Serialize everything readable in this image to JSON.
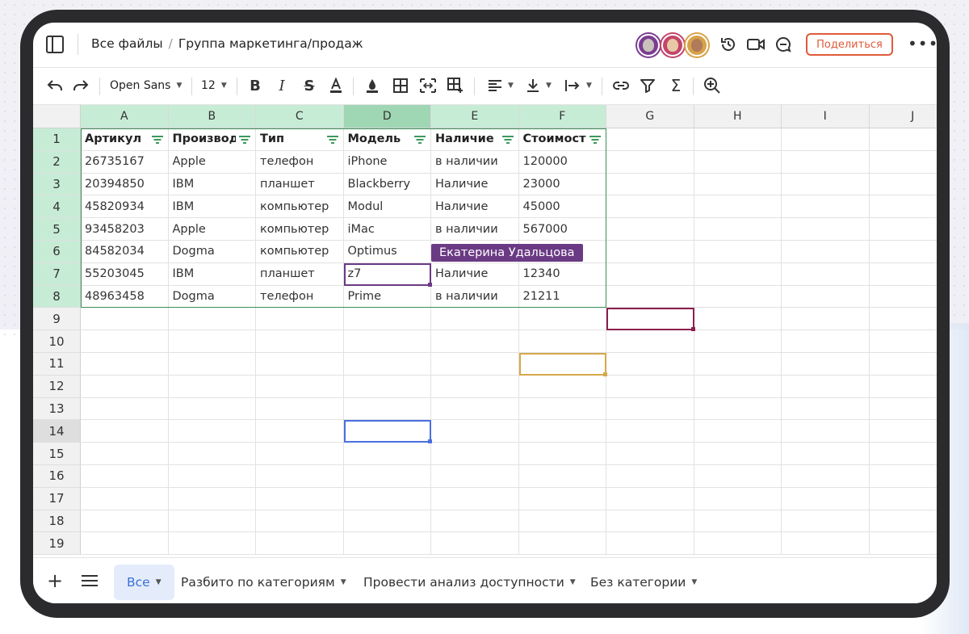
{
  "breadcrumb": {
    "root": "Все файлы",
    "separator": "/",
    "current": "Группа маркетинга/продаж"
  },
  "header": {
    "share_label": "Поделиться",
    "more_label": "•••"
  },
  "toolbar": {
    "font_family": "Open Sans",
    "font_size": "12"
  },
  "columns": [
    "A",
    "B",
    "C",
    "D",
    "E",
    "F",
    "G",
    "H",
    "I",
    "J"
  ],
  "rows": [
    "1",
    "2",
    "3",
    "4",
    "5",
    "6",
    "7",
    "8",
    "9",
    "10",
    "11",
    "12",
    "13",
    "14",
    "15",
    "16",
    "17",
    "18",
    "19"
  ],
  "table": {
    "headers": [
      "Артикул",
      "Производитель",
      "Тип",
      "Модель",
      "Наличие",
      "Стоимость"
    ],
    "rows": [
      [
        "26735167",
        "Apple",
        "телефон",
        "iPhone",
        "в наличии",
        "120000"
      ],
      [
        "20394850",
        "IBM",
        "планшет",
        "Blackberry",
        "Наличие",
        "23000"
      ],
      [
        "45820934",
        "IBM",
        "компьютер",
        "Modul",
        "Наличие",
        "45000"
      ],
      [
        "93458203",
        "Apple",
        "компьютер",
        "iMac",
        "в наличии",
        "567000"
      ],
      [
        "84582034",
        "Dogma",
        "компьютер",
        "Optimus",
        "",
        ""
      ],
      [
        "55203045",
        "IBM",
        "планшет",
        "z7",
        "Наличие",
        "12340"
      ],
      [
        "48963458",
        "Dogma",
        "телефон",
        "Prime",
        "в наличии",
        "21211"
      ]
    ]
  },
  "collaborator_tag": "Екатерина Удальцова",
  "colors": {
    "accent_green": "#3b8e57",
    "collab_purple": "#6b3a84",
    "collab_maroon": "#8a1f4e",
    "collab_gold": "#d6a84a",
    "collab_blue": "#4a6fe0",
    "share_red": "#e05a3a"
  },
  "sheets": [
    {
      "label": "Все",
      "active": true
    },
    {
      "label": "Разбито по категориям",
      "active": false
    },
    {
      "label": "Провести анализ доступности",
      "active": false
    },
    {
      "label": "Без категории",
      "active": false
    }
  ]
}
